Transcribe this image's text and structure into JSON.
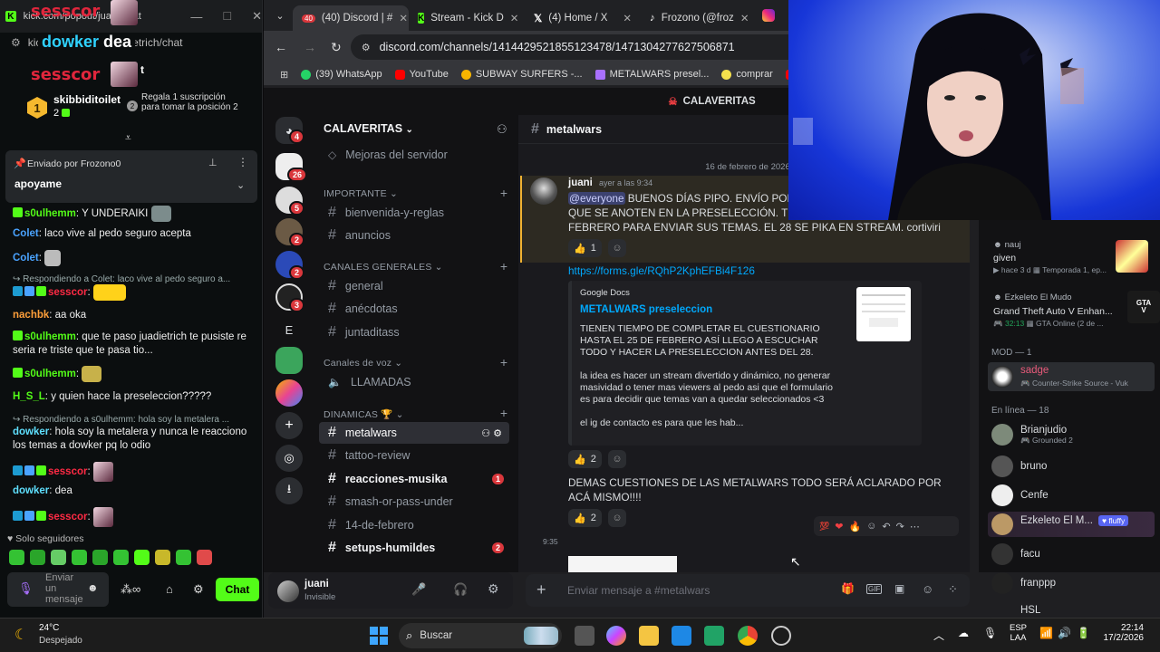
{
  "kick": {
    "tab_title": "kick.com/popout/juadi...hat",
    "url": "kick.com/popout/juadietrich/chat",
    "overlay": {
      "top_name": "sesscor",
      "mid_name": "dowker",
      "mid_text": "dea",
      "bottom_name": "sesscor",
      "bottom_suffix": "t"
    },
    "leaderboard": {
      "rank": "1",
      "user": "skibbiditoilet",
      "count": "2",
      "rank2": "2",
      "gift_text": "Regala 1 suscripción para tomar la posición 2"
    },
    "pinned": {
      "label": "Enviado por",
      "by": "Frozono0",
      "text": "apoyame"
    },
    "messages": [
      {
        "user": "s0ulhemm",
        "text": "Y UNDERAIKI"
      },
      {
        "user": "Colet",
        "text": "laco vive al pedo seguro acepta"
      },
      {
        "user": "Colet",
        "text": ""
      },
      {
        "reply": "Respondiendo a Colet: laco vive al pedo seguro a..."
      },
      {
        "user": "sesscor",
        "text": ""
      },
      {
        "user": "nachbk",
        "text": "aa oka"
      },
      {
        "user": "s0ulhemm",
        "text": "que te paso juadietrich te pusiste re seria re triste que te pasa tio..."
      },
      {
        "user": "s0ulhemm",
        "text": ""
      },
      {
        "user": "H_S_L",
        "text": "y quien hace la preseleccion?????"
      },
      {
        "reply": "Respondiendo a s0ulhemm: hola soy la metalera ..."
      },
      {
        "user": "dowker",
        "text": "hola soy la metalera y nunca le reacciono los temas a dowker pq lo odio"
      },
      {
        "user": "sesscor",
        "text": ""
      },
      {
        "user": "dowker",
        "text": "dea"
      },
      {
        "user": "sesscor",
        "text": ""
      }
    ],
    "followers_only": "Solo seguidores",
    "input_placeholder": "Enviar un mensaje",
    "chat_button": "Chat"
  },
  "browser": {
    "tabs": [
      {
        "title": "(40) Discord | #"
      },
      {
        "title": "Stream - Kick D"
      },
      {
        "title": "(4) Home / X"
      },
      {
        "title": "Frozono (@froz"
      }
    ],
    "discord_badge": "40",
    "url": "discord.com/channels/1414429521855123478/1471304277627506871",
    "bookmarks": [
      {
        "label": "(39) WhatsApp",
        "color": "#25d366"
      },
      {
        "label": "YouTube",
        "color": "#ff0000"
      },
      {
        "label": "SUBWAY SURFERS -...",
        "color": "#f7b500"
      },
      {
        "label": "METALWARS presel...",
        "color": "#a970ff"
      },
      {
        "label": "comprar",
        "color": "#f4e04d"
      },
      {
        "label": "outr",
        "color": "#ff0000"
      }
    ]
  },
  "discord": {
    "server_header": "CALAVERITAS",
    "server_name": "CALAVERITAS",
    "guild_badges": [
      "4",
      "26",
      "5",
      "2",
      "2",
      "3"
    ],
    "guild_letter": "E",
    "boost_item": "Mejoras del servidor",
    "categories": [
      "IMPORTANTE",
      "CANALES GENERALES",
      "Canales de voz",
      "DINAMICAS"
    ],
    "channels_important": [
      "bienvenida-y-reglas",
      "anuncios"
    ],
    "channels_general": [
      "general",
      "anécdotas",
      "juntaditass"
    ],
    "voice_channel": "LLAMADAS",
    "channels_dinamicas": [
      {
        "name": "metalwars",
        "state": "selected"
      },
      {
        "name": "tattoo-review",
        "state": "normal"
      },
      {
        "name": "reacciones-musika",
        "state": "unread",
        "badge": "1"
      },
      {
        "name": "smash-or-pass-under",
        "state": "normal"
      },
      {
        "name": "14-de-febrero",
        "state": "normal"
      },
      {
        "name": "setups-humildes",
        "state": "unread",
        "badge": "2"
      }
    ],
    "user": {
      "name": "juani",
      "status": "Invisible"
    },
    "channel": "metalwars",
    "date_divider": "16 de febrero de 2026",
    "message": {
      "author": "juani",
      "time": "ayer a las 9:34",
      "mention": "@everyone",
      "line1": "BUENOS DÍAS PIPO. ENVÍO POR AC",
      "line2": "QUE SE ANOTEN EN LA PRESELECCIÓN. TIENE",
      "line3": "FEBRERO PARA ENVIAR SUS TEMAS. EL 28 SE PIKA EN STREAM. cortiviri",
      "reaction1": "1",
      "link": "https://forms.gle/RQhP2KphEFBi4F126",
      "reaction2": "2",
      "followup": "DEMAS CUESTIONES DE LAS METALWARS TODO SERÁ ACLARADO POR ACÁ MISMO!!!!",
      "reaction3": "2",
      "next_time": "9:35"
    },
    "embed": {
      "provider": "Google Docs",
      "title": "METALWARS preseleccion",
      "desc1": "TIENEN TIEMPO DE COMPLETAR EL CUESTIONARIO HASTA EL 25 DE FEBRERO ASÍ LLEGO A ESCUCHAR TODO Y HACER LA PRESELECCION ANTES DEL 28.",
      "desc2": "la idea es hacer un stream divertido y dinámico, no generar masividad o tener mas viewers al pedo asi que el formulario es para decidir que temas van a quedar seleccionados <3",
      "desc3": "el ig de contacto es para que les hab..."
    },
    "input_placeholder": "Enviar mensaje a #metalwars",
    "members": {
      "activity1": {
        "name": "nauj",
        "status": "given",
        "detail": "hace 3 d",
        "extra": "Temporada 1, ep..."
      },
      "activity2": {
        "name": "Ezkeleto El Mudo",
        "game": "Grand Theft Auto V Enhan...",
        "time": "32:13",
        "detail": "GTA Online (2 de ..."
      },
      "mod_header": "MOD — 1",
      "mod": {
        "name": "sadge",
        "status": "Counter-Strike Source - Vuk"
      },
      "online_header": "En línea — 18",
      "online": [
        {
          "name": "Brianjudio",
          "status": "Grounded 2"
        },
        {
          "name": "bruno",
          "status": ""
        },
        {
          "name": "Cenfe",
          "status": ""
        },
        {
          "name": "Ezkeleto El M...",
          "status": "",
          "tag": "fluffy"
        },
        {
          "name": "facu",
          "status": ""
        },
        {
          "name": "franppp",
          "status": ""
        },
        {
          "name": "HSL",
          "status": ""
        }
      ]
    }
  },
  "taskbar": {
    "temp": "24°C",
    "weather": "Despejado",
    "search": "Buscar",
    "lang1": "ESP",
    "lang2": "LAA",
    "time": "22:14",
    "date": "17/2/2026"
  }
}
